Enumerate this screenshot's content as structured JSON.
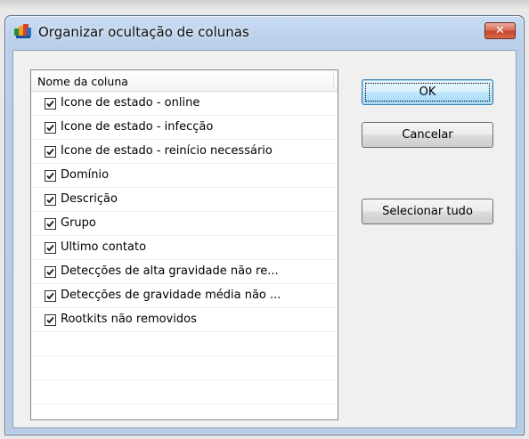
{
  "window": {
    "title": "Organizar ocultação de colunas",
    "close_label": "✕"
  },
  "list": {
    "column_header": "Nome da coluna",
    "items": [
      {
        "label": "Ícone de estado - online",
        "checked": true
      },
      {
        "label": "Ícone de estado - infecção",
        "checked": true
      },
      {
        "label": "Ícone de estado - reinício necessário",
        "checked": true
      },
      {
        "label": "Domínio",
        "checked": true
      },
      {
        "label": "Descrição",
        "checked": true
      },
      {
        "label": "Grupo",
        "checked": true
      },
      {
        "label": "Último contato",
        "checked": true
      },
      {
        "label": "Detecções de alta gravidade não re...",
        "checked": true
      },
      {
        "label": "Detecções de gravidade média não ...",
        "checked": true
      },
      {
        "label": "Rootkits não removidos",
        "checked": true
      }
    ],
    "empty_rows": 4
  },
  "buttons": {
    "ok": "OK",
    "cancel": "Cancelar",
    "select_all": "Selecionar tudo"
  },
  "icons": {
    "app": "avg-logo-icon",
    "close": "close-icon",
    "check": "checkmark-icon"
  },
  "colors": {
    "title_bar": "#b9cfe9",
    "close_button": "#c8452f",
    "default_button_border": "#3c7fb1"
  }
}
